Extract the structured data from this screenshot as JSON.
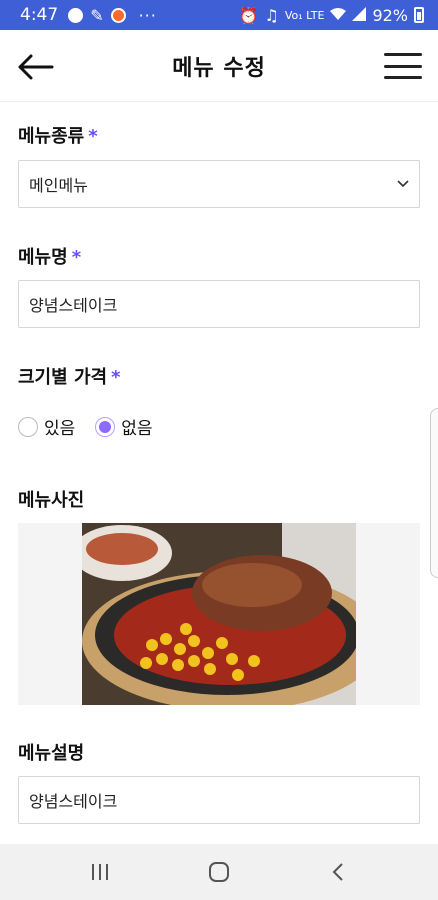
{
  "status_bar": {
    "time": "4:47",
    "more": "···",
    "network": "Vo₁ LTE",
    "battery": "92%"
  },
  "appbar": {
    "title": "메뉴 수정",
    "back_icon": "arrow-left-icon",
    "menu_icon": "hamburger-icon"
  },
  "form": {
    "menu_type": {
      "label": "메뉴종류",
      "required_mark": "*",
      "selected": "메인메뉴"
    },
    "menu_name": {
      "label": "메뉴명",
      "required_mark": "*",
      "value": "양념스테이크"
    },
    "size_price": {
      "label": "크기별 가격",
      "required_mark": "*",
      "options": [
        {
          "label": "있음",
          "checked": false
        },
        {
          "label": "없음",
          "checked": true
        }
      ]
    },
    "menu_photo": {
      "label": "메뉴사진"
    },
    "menu_description": {
      "label": "메뉴설명",
      "value": "양념스테이크"
    }
  },
  "colors": {
    "status_bar": "#3f5fd6",
    "required_mark": "#6a4bff",
    "radio_checked": "#8e6bff"
  },
  "nav": {
    "recent_icon": "recent-apps-icon",
    "home_icon": "home-icon",
    "back_icon": "back-chevron-icon"
  }
}
